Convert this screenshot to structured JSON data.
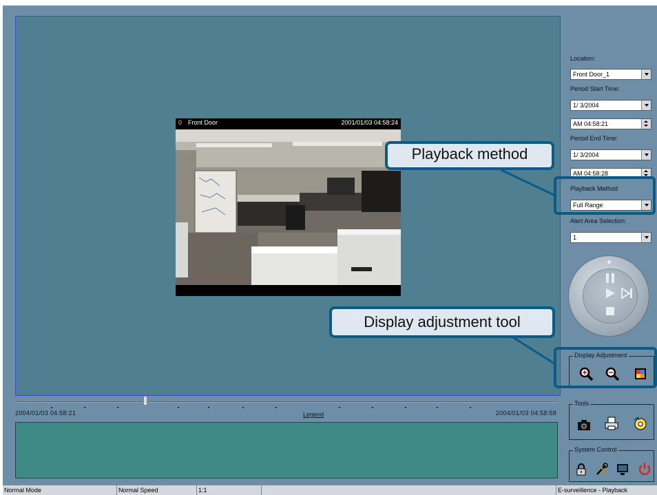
{
  "camera": {
    "index": "0",
    "name": "Front Door",
    "timestamp": "2001/01/03 04:58:24"
  },
  "timeline": {
    "start": "2004/01/03 04:58:21",
    "end": "2004/01/03 04:58:58",
    "legend": "Legend"
  },
  "panel": {
    "location_label": "Location:",
    "location_value": "Front Door_1",
    "start_label": "Period Start Time:",
    "start_date": "1/ 3/2004",
    "start_time": "AM 04:58:21",
    "end_label": "Period End Time:",
    "end_date": "1/ 3/2004",
    "end_time": "AM 04:58:28",
    "method_label": "Playback Method",
    "method_value": "Full Range",
    "alert_label": "Alert Area Selection:",
    "alert_value": "1"
  },
  "groups": {
    "display": "Display Adjustment",
    "tools": "Tools",
    "system": "System Control"
  },
  "statusbar": {
    "mode": "Normal Mode",
    "speed": "Normal Speed",
    "ratio": "1:1",
    "app": "E-surveillence - Playback"
  },
  "callouts": {
    "playback": "Playback method",
    "display": "Display adjustment tool"
  },
  "colors": {
    "viewport": "#4f7f90",
    "panel": "#6e8ea8",
    "callout_border": "#0b5b86",
    "power": "#e0231b"
  }
}
